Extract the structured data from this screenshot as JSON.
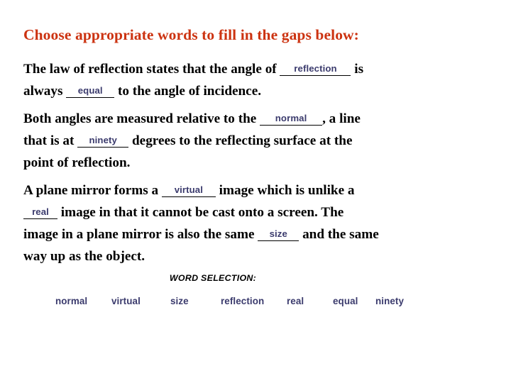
{
  "slide": {
    "title": "Choose appropriate words to fill in the gaps below:",
    "title_color": "#cc3311",
    "background_color": "#ffffff",
    "answer_color": "#3b3b6d",
    "body_color": "#000000"
  },
  "paragraphs": [
    {
      "id": "para-1",
      "lines": [
        {
          "segments": [
            {
              "kind": "text",
              "value": "The law of reflection states that the angle of "
            },
            {
              "kind": "blank",
              "value": "reflection",
              "slot": "reflection"
            },
            {
              "kind": "text",
              "value": " is"
            }
          ]
        },
        {
          "segments": [
            {
              "kind": "text",
              "value": "always "
            },
            {
              "kind": "blank",
              "value": "equal",
              "slot": "equal"
            },
            {
              "kind": "text",
              "value": " to the angle of incidence."
            }
          ]
        }
      ]
    },
    {
      "id": "para-2",
      "lines": [
        {
          "segments": [
            {
              "kind": "text",
              "value": "Both angles are measured relative to the "
            },
            {
              "kind": "blank",
              "value": "normal",
              "slot": "normal"
            },
            {
              "kind": "text",
              "value": ", a line"
            }
          ]
        },
        {
          "segments": [
            {
              "kind": "text",
              "value": "that is at "
            },
            {
              "kind": "blank",
              "value": "ninety",
              "slot": "ninety"
            },
            {
              "kind": "text",
              "value": " degrees to the reflecting surface at the"
            }
          ]
        },
        {
          "segments": [
            {
              "kind": "text",
              "value": "point of reflection."
            }
          ]
        }
      ]
    },
    {
      "id": "para-3",
      "lines": [
        {
          "segments": [
            {
              "kind": "text",
              "value": "A plane mirror forms a "
            },
            {
              "kind": "blank",
              "value": "virtual",
              "slot": "virtual"
            },
            {
              "kind": "text",
              "value": " image which is unlike a"
            }
          ]
        },
        {
          "segments": [
            {
              "kind": "blank",
              "value": "real",
              "slot": "real"
            },
            {
              "kind": "text",
              "value": " image in that it cannot be cast onto a screen. The"
            }
          ]
        },
        {
          "segments": [
            {
              "kind": "text",
              "value": "image in a plane mirror is also the same "
            },
            {
              "kind": "blank",
              "value": "size",
              "slot": "size"
            },
            {
              "kind": "text",
              "value": " and the same"
            }
          ]
        },
        {
          "segments": [
            {
              "kind": "text",
              "value": "way up as the object."
            }
          ]
        }
      ]
    }
  ],
  "word_selection": {
    "heading": "WORD SELECTION:",
    "words": [
      "normal",
      "virtual",
      "size",
      "reflection",
      "real",
      "equal",
      "ninety"
    ]
  }
}
